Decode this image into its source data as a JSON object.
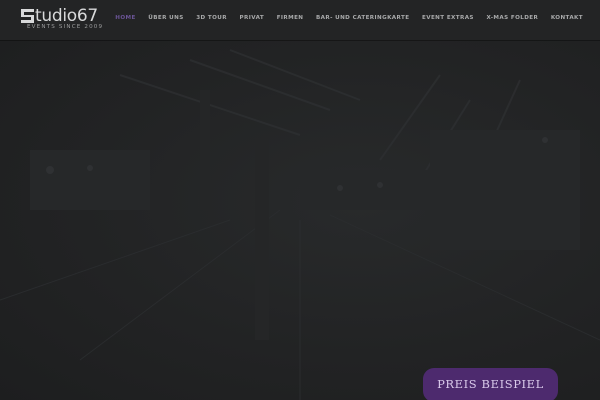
{
  "brand": {
    "logo_text": "tudio67",
    "tagline": "EVENTS SINCE 2009"
  },
  "nav": {
    "items": [
      {
        "label": "HOME",
        "active": true
      },
      {
        "label": "ÜBER UNS"
      },
      {
        "label": "3D TOUR"
      },
      {
        "label": "PRIVAT"
      },
      {
        "label": "FIRMEN"
      },
      {
        "label": "BAR- UND CATERINGKARTE"
      },
      {
        "label": "EVENT EXTRAS"
      },
      {
        "label": "X-MAS FOLDER"
      },
      {
        "label": "KONTAKT"
      }
    ]
  },
  "hero": {
    "cta_label": "PREIS BEISPIEL"
  },
  "colors": {
    "accent": "#6a5496",
    "cta_bg": "#4d2a6e",
    "header_bg": "#232425",
    "page_bg": "#1f2021"
  }
}
